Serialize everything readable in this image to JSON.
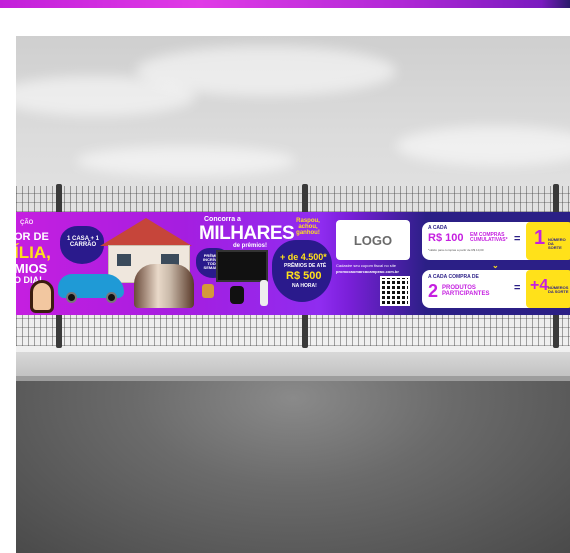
{
  "banner": {
    "left_fragment": {
      "line1": "ÇÃO",
      "line2": "OR DE",
      "line3": "ÍLIA,",
      "line4": "MIOS",
      "line5": "O DIA!"
    },
    "heart_label": "1 CASA + 1 CARRÃO",
    "headline_small": "Concorra a",
    "headline_big": "MILHARES",
    "headline_sub": "de prêmios!",
    "weekly_label": "PRÊMIOS INCRÍVEIS TODA SEMANA*",
    "instant_tag": "Raspou, achou, ganhou!",
    "instant_count": "+ de 4.500*",
    "instant_desc": "PRÊMIOS DE ATÉ",
    "instant_value": "R$ 500",
    "instant_note": "NA HORA!",
    "logo": "LOGO",
    "register_text": "Cadastre seu cupom fiscal no site",
    "site": "promocaomarcacampeao.com.br",
    "offer1_small": "A CADA",
    "offer1_value": "R$ 100",
    "offer1_desc": "EM COMPRAS CUMULATIVAS*",
    "offer1_note": "*válido para compras a partir de R$ 10,00",
    "offer1_eq": "=",
    "offer1_num": "1",
    "offer1_num_label": "NÚMERO DA SORTE",
    "offer2_small": "A CADA COMPRA DE",
    "offer2_value": "2",
    "offer2_desc": "PRODUTOS PARTICIPANTES",
    "offer2_eq": "=",
    "offer2_num": "+4",
    "offer2_num_label": "NÚMEROS DA SORTE"
  },
  "colors": {
    "purple": "#b01fe0",
    "navy": "#2b1f86",
    "yellow": "#ffe11a"
  }
}
